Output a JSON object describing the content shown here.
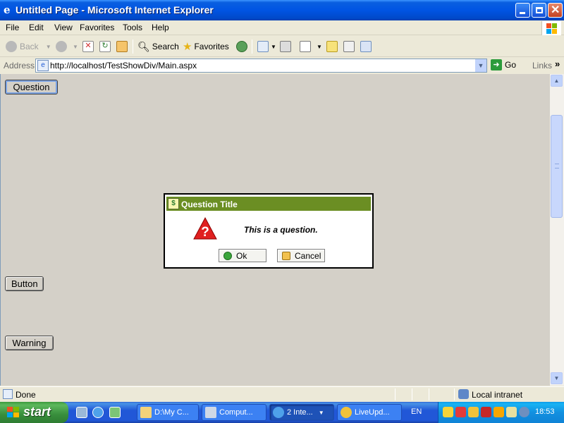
{
  "window": {
    "title": "Untitled Page - Microsoft Internet Explorer",
    "app_icon": "ie-icon"
  },
  "menu": {
    "items": [
      {
        "label": "File"
      },
      {
        "label": "Edit"
      },
      {
        "label": "View"
      },
      {
        "label": "Favorites"
      },
      {
        "label": "Tools"
      },
      {
        "label": "Help"
      }
    ]
  },
  "toolbar": {
    "back_label": "Back",
    "search_label": "Search",
    "favorites_label": "Favorites"
  },
  "address": {
    "label": "Address",
    "url": "http://localhost/TestShowDiv/Main.aspx",
    "go_label": "Go",
    "links_label": "Links"
  },
  "page": {
    "question_button": "Question",
    "button_button": "Button",
    "warning_button": "Warning"
  },
  "dialog": {
    "title": "Question Title",
    "message": "This is a question.",
    "ok_label": "Ok",
    "cancel_label": "Cancel"
  },
  "status": {
    "text": "Done",
    "zone": "Local intranet"
  },
  "taskbar": {
    "start_label": "start",
    "tasks": [
      {
        "label": "D:\\My C..."
      },
      {
        "label": "Comput..."
      },
      {
        "label": "2 Inte..."
      },
      {
        "label": "LiveUpd..."
      }
    ],
    "language": "EN",
    "clock": "18:53"
  },
  "colors": {
    "dialog_title_bg": "#6b8e23",
    "page_bg": "#d4d0c8",
    "titlebar_blue": "#0054e3",
    "start_green": "#388e3c"
  }
}
